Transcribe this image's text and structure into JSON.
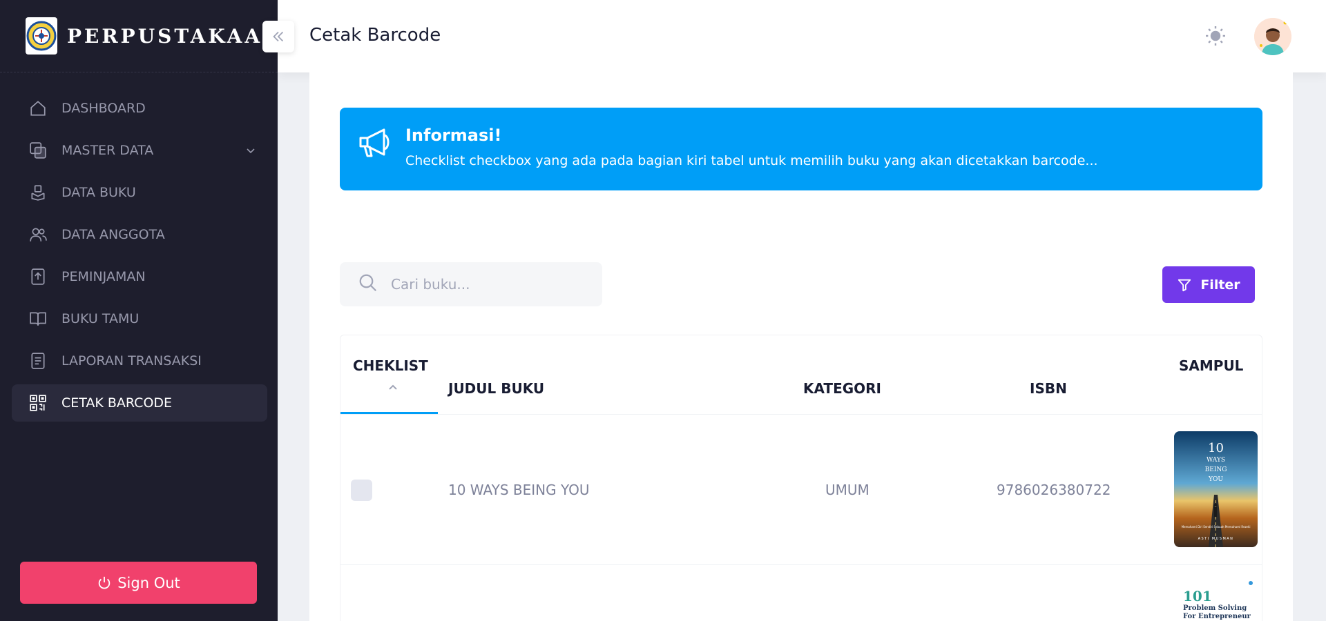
{
  "brand": {
    "name": "PERPUSTAKAAN"
  },
  "header": {
    "title": "Cetak Barcode"
  },
  "sidebar": {
    "items": [
      {
        "label": "DASHBOARD",
        "icon": "home-icon"
      },
      {
        "label": "MASTER DATA",
        "icon": "layers-icon"
      },
      {
        "label": "DATA BUKU",
        "icon": "book-hand-icon"
      },
      {
        "label": "DATA ANGGOTA",
        "icon": "users-icon"
      },
      {
        "label": "PEMINJAMAN",
        "icon": "upload-doc-icon"
      },
      {
        "label": "BUKU TAMU",
        "icon": "open-book-icon"
      },
      {
        "label": "LAPORAN TRANSAKSI",
        "icon": "report-icon"
      },
      {
        "label": "CETAK BARCODE",
        "icon": "qrcode-icon",
        "active": true
      }
    ],
    "signout_label": "Sign Out"
  },
  "alert": {
    "title": "Informasi!",
    "text": "Checklist checkbox yang ada pada bagian kiri tabel untuk memilih buku yang akan dicetakkan barcode..."
  },
  "search": {
    "placeholder": "Cari buku..."
  },
  "filter_label": "Filter",
  "table": {
    "headers": {
      "checklist": "CHEKLIST",
      "title": "JUDUL BUKU",
      "category": "KATEGORI",
      "isbn": "ISBN",
      "cover": "SAMPUL"
    },
    "rows": [
      {
        "title": "10 WAYS BEING YOU",
        "category": "UMUM",
        "isbn": "9786026380722",
        "cover": {
          "lines": [
            "10",
            "WAYS",
            "BEING",
            "YOU"
          ],
          "author": "ASTI MUSMAN",
          "subtitle": "Memahami Diri Sendiri Sebuah Memahami Rezeki"
        }
      },
      {
        "cover": {
          "number": "101",
          "lines": [
            "Problem Solving",
            "For Entrepreneur"
          ]
        }
      }
    ]
  },
  "colors": {
    "sidebar": "#1e1e2d",
    "primary": "#009ef7",
    "filter": "#7239ea",
    "danger": "#f1416c"
  }
}
